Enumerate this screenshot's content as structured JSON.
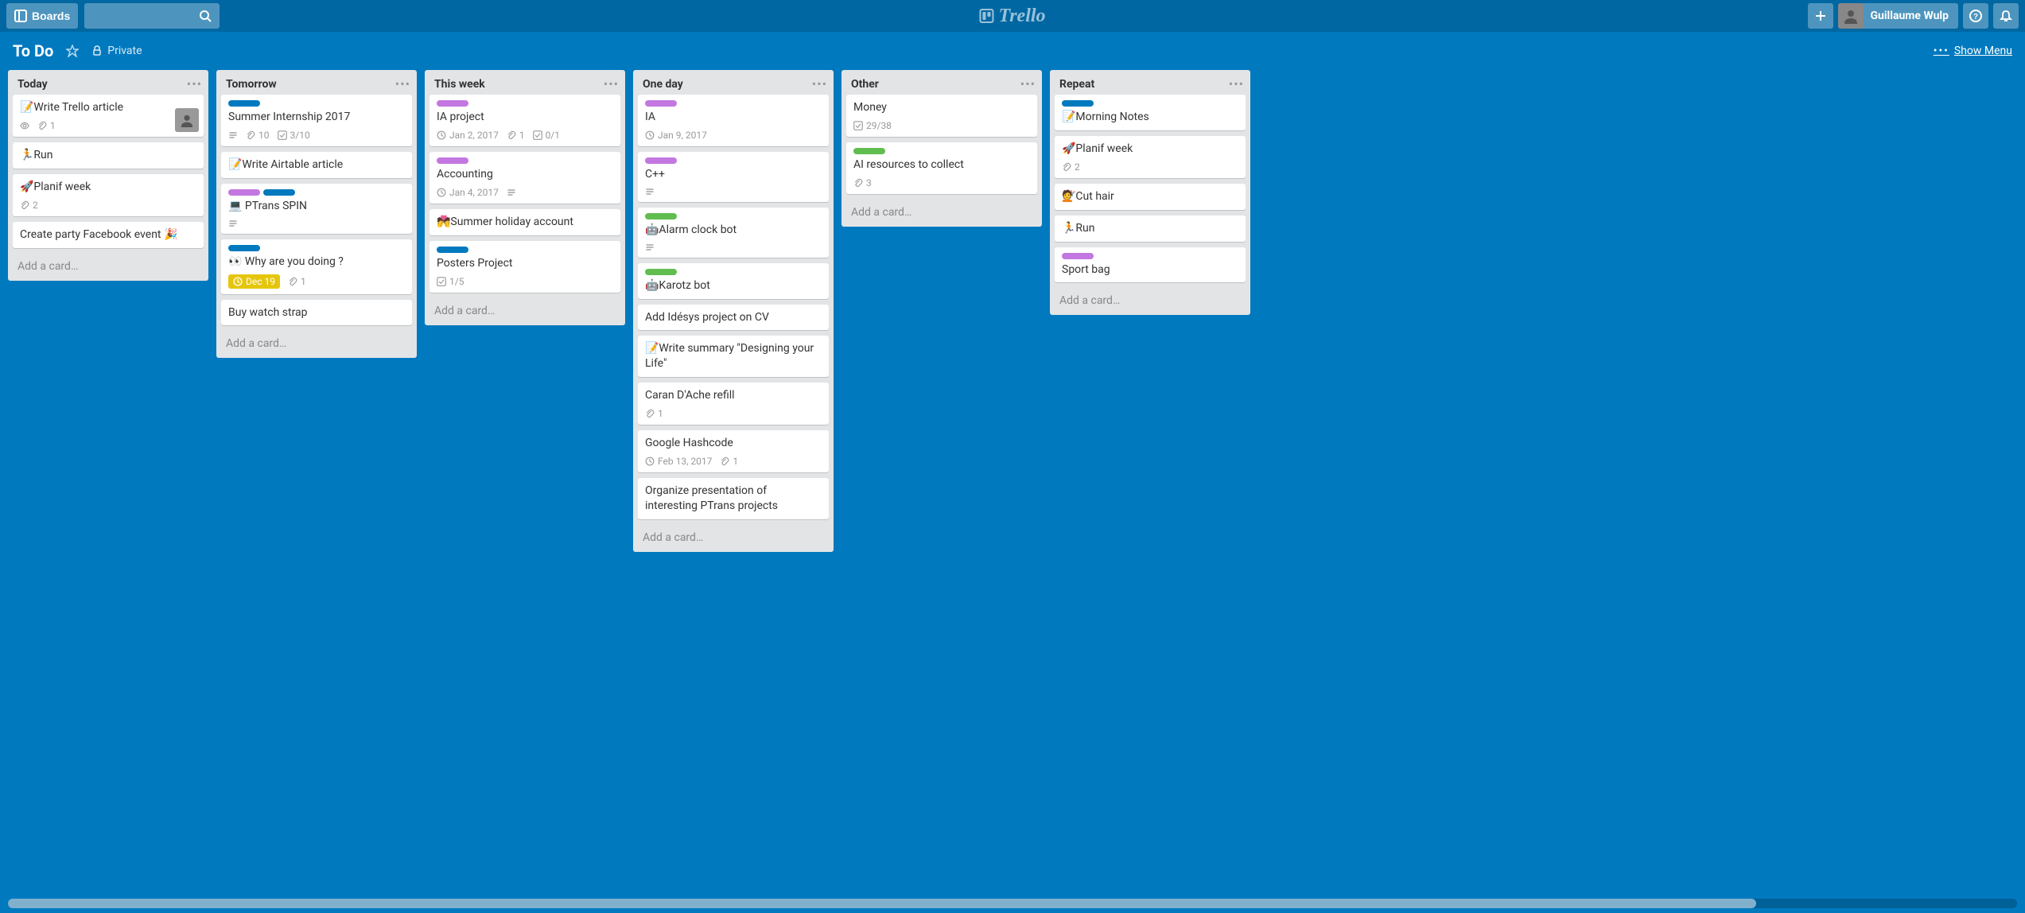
{
  "header": {
    "boards_label": "Boards",
    "logo_text": "Trello",
    "user_name": "Guillaume Wulp"
  },
  "board_header": {
    "title": "To Do",
    "privacy": "Private",
    "show_menu": "Show Menu"
  },
  "lists": [
    {
      "title": "Today",
      "add_card": "Add a card…",
      "cards": [
        {
          "title": "📝Write Trello article",
          "badges": {
            "eye": true,
            "attach": "1"
          },
          "avatar": true
        },
        {
          "title": "🏃Run"
        },
        {
          "title": "🚀Planif week",
          "badges": {
            "attach": "2"
          }
        },
        {
          "title": "Create party Facebook event 🎉"
        }
      ]
    },
    {
      "title": "Tomorrow",
      "add_card": "Add a card…",
      "cards": [
        {
          "labels": [
            "blue"
          ],
          "title": "Summer Internship 2017",
          "badges": {
            "desc": true,
            "attach": "10",
            "check": "3/10"
          }
        },
        {
          "title": "📝Write Airtable article"
        },
        {
          "labels": [
            "purple",
            "blue"
          ],
          "title": "💻 PTrans SPIN",
          "badges": {
            "desc": true
          }
        },
        {
          "labels": [
            "blue"
          ],
          "title": "👀 Why are you doing ?",
          "badges": {
            "due": "Dec 19",
            "due_soon": true,
            "attach": "1"
          }
        },
        {
          "title": "Buy watch strap"
        }
      ]
    },
    {
      "title": "This week",
      "add_card": "Add a card…",
      "cards": [
        {
          "labels": [
            "purple"
          ],
          "title": "IA project",
          "badges": {
            "date": "Jan 2, 2017",
            "attach": "1",
            "check": "0/1"
          }
        },
        {
          "labels": [
            "purple"
          ],
          "title": "Accounting",
          "badges": {
            "date": "Jan 4, 2017",
            "desc": true
          }
        },
        {
          "title": "💏Summer holiday account"
        },
        {
          "labels": [
            "blue"
          ],
          "title": "Posters Project",
          "badges": {
            "check": "1/5"
          }
        }
      ]
    },
    {
      "title": "One day",
      "add_card": "Add a card…",
      "cards": [
        {
          "labels": [
            "purple"
          ],
          "title": "IA",
          "badges": {
            "date": "Jan 9, 2017"
          }
        },
        {
          "labels": [
            "purple"
          ],
          "title": "C++",
          "badges": {
            "desc": true
          }
        },
        {
          "labels": [
            "green"
          ],
          "title": "🤖Alarm clock bot",
          "badges": {
            "desc": true
          }
        },
        {
          "labels": [
            "green"
          ],
          "title": "🤖Karotz bot"
        },
        {
          "title": "Add Idésys project on CV"
        },
        {
          "title": "📝Write summary \"Designing your Life\""
        },
        {
          "title": "Caran D'Ache refill",
          "badges": {
            "attach": "1"
          }
        },
        {
          "title": "Google Hashcode",
          "badges": {
            "date": "Feb 13, 2017",
            "attach": "1"
          }
        },
        {
          "title": "Organize presentation of interesting PTrans projects"
        }
      ]
    },
    {
      "title": "Other",
      "add_card": "Add a card…",
      "cards": [
        {
          "title": "Money",
          "badges": {
            "check": "29/38"
          }
        },
        {
          "labels": [
            "green"
          ],
          "title": "AI resources to collect",
          "badges": {
            "attach": "3"
          }
        }
      ]
    },
    {
      "title": "Repeat",
      "add_card": "Add a card…",
      "cards": [
        {
          "labels": [
            "blue"
          ],
          "title": "📝Morning Notes"
        },
        {
          "title": "🚀Planif week",
          "badges": {
            "attach": "2"
          }
        },
        {
          "title": "💇Cut hair"
        },
        {
          "title": "🏃Run"
        },
        {
          "labels": [
            "purple"
          ],
          "title": "Sport bag"
        }
      ]
    }
  ]
}
